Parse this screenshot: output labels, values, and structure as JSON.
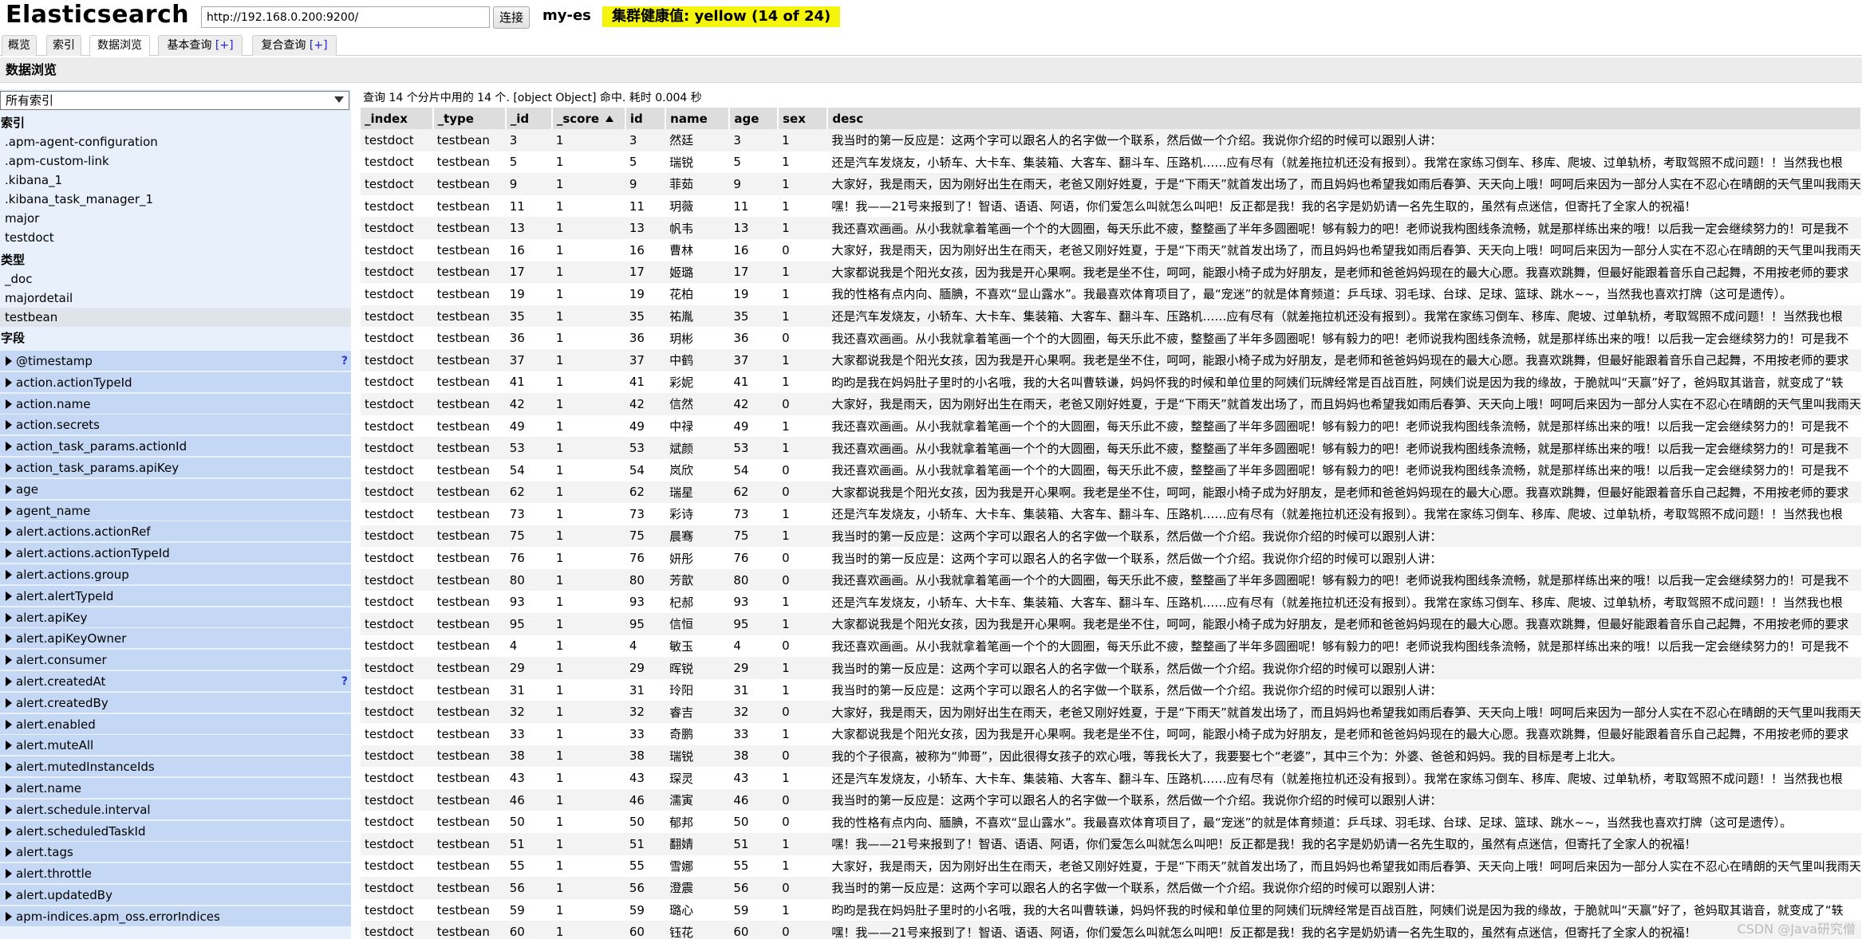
{
  "header": {
    "logo": "Elasticsearch",
    "url": "http://192.168.0.200:9200/",
    "connect_label": "连接",
    "cluster_name": "my-es",
    "health_text": "集群健康值: yellow (14 of 24)",
    "health_color": "#f4f40d"
  },
  "tabs": [
    {
      "label": "概览",
      "plus": ""
    },
    {
      "label": "索引",
      "plus": ""
    },
    {
      "label": "数据浏览",
      "plus": ""
    },
    {
      "label": "基本查询 ",
      "plus": "[+]"
    },
    {
      "label": "复合查询 ",
      "plus": "[+]"
    }
  ],
  "page_title": "数据浏览",
  "sidebar": {
    "index_select": "所有索引",
    "indices_label": "索引",
    "indices": [
      ".apm-agent-configuration",
      ".apm-custom-link",
      ".kibana_1",
      ".kibana_task_manager_1",
      "major",
      "testdoct"
    ],
    "types_label": "类型",
    "types": [
      "_doc",
      "majordetail",
      "testbean"
    ],
    "fields_label": "字段",
    "fields": [
      {
        "name": "@timestamp",
        "help": "?"
      },
      {
        "name": "action.actionTypeId",
        "help": ""
      },
      {
        "name": "action.name",
        "help": ""
      },
      {
        "name": "action.secrets",
        "help": ""
      },
      {
        "name": "action_task_params.actionId",
        "help": ""
      },
      {
        "name": "action_task_params.apiKey",
        "help": ""
      },
      {
        "name": "age",
        "help": ""
      },
      {
        "name": "agent_name",
        "help": ""
      },
      {
        "name": "alert.actions.actionRef",
        "help": ""
      },
      {
        "name": "alert.actions.actionTypeId",
        "help": ""
      },
      {
        "name": "alert.actions.group",
        "help": ""
      },
      {
        "name": "alert.alertTypeId",
        "help": ""
      },
      {
        "name": "alert.apiKey",
        "help": ""
      },
      {
        "name": "alert.apiKeyOwner",
        "help": ""
      },
      {
        "name": "alert.consumer",
        "help": ""
      },
      {
        "name": "alert.createdAt",
        "help": "?"
      },
      {
        "name": "alert.createdBy",
        "help": ""
      },
      {
        "name": "alert.enabled",
        "help": ""
      },
      {
        "name": "alert.muteAll",
        "help": ""
      },
      {
        "name": "alert.mutedInstanceIds",
        "help": ""
      },
      {
        "name": "alert.name",
        "help": ""
      },
      {
        "name": "alert.schedule.interval",
        "help": ""
      },
      {
        "name": "alert.scheduledTaskId",
        "help": ""
      },
      {
        "name": "alert.tags",
        "help": ""
      },
      {
        "name": "alert.throttle",
        "help": ""
      },
      {
        "name": "alert.updatedBy",
        "help": ""
      },
      {
        "name": "apm-indices.apm_oss.errorIndices",
        "help": ""
      }
    ]
  },
  "results": {
    "summary": "查询 14 个分片中用的 14 个. [object Object] 命中. 耗时 0.004 秒",
    "columns": [
      "_index",
      "_type",
      "_id",
      "_score",
      "id",
      "name",
      "age",
      "sex",
      "desc"
    ],
    "rows": [
      [
        "testdoct",
        "testbean",
        "3",
        "1",
        "3",
        "然廷",
        "3",
        "1",
        "我当时的第一反应是：这两个字可以跟名人的名字做一个联系，然后做一个介绍。我说你介绍的时候可以跟别人讲："
      ],
      [
        "testdoct",
        "testbean",
        "5",
        "1",
        "5",
        "瑞锐",
        "5",
        "1",
        "还是汽车发烧友，小轿车、大卡车、集装箱、大客车、翻斗车、压路机……应有尽有（就差拖拉机还没有报到）。我常在家练习倒车、移库、爬坡、过单轨桥，考取驾照不成问题！！当然我也根"
      ],
      [
        "testdoct",
        "testbean",
        "9",
        "1",
        "9",
        "菲茹",
        "9",
        "1",
        "大家好，我是雨天，因为刚好出生在雨天，老爸又刚好姓夏，于是“下雨天”就首发出场了，而且妈妈也希望我如雨后春笋、天天向上哦！呵呵后来因为一部分人实在不忍心在晴朗的天气里叫我雨天"
      ],
      [
        "testdoct",
        "testbean",
        "11",
        "1",
        "11",
        "玥薇",
        "11",
        "1",
        "嘿！我——21号来报到了！智语、语语、阿语，你们爱怎么叫就怎么叫吧！反正都是我！我的名字是奶奶请一名先生取的，虽然有点迷信，但寄托了全家人的祝福！"
      ],
      [
        "testdoct",
        "testbean",
        "13",
        "1",
        "13",
        "帆韦",
        "13",
        "1",
        "我还喜欢画画。从小我就拿着笔画一个个的大圆圈，每天乐此不疲，整整画了半年多圆圈呢！够有毅力的吧！老师说我构图线条流畅，就是那样练出来的哦！以后我一定会继续努力的！可是我不"
      ],
      [
        "testdoct",
        "testbean",
        "16",
        "1",
        "16",
        "曹林",
        "16",
        "0",
        "大家好，我是雨天，因为刚好出生在雨天，老爸又刚好姓夏，于是“下雨天”就首发出场了，而且妈妈也希望我如雨后春笋、天天向上哦！呵呵后来因为一部分人实在不忍心在晴朗的天气里叫我雨天"
      ],
      [
        "testdoct",
        "testbean",
        "17",
        "1",
        "17",
        "姬璐",
        "17",
        "1",
        "大家都说我是个阳光女孩，因为我是开心果啊。我老是坐不住，呵呵，能跟小椅子成为好朋友，是老师和爸爸妈妈现在的最大心愿。我喜欢跳舞，但最好能跟着音乐自己起舞，不用按老师的要求"
      ],
      [
        "testdoct",
        "testbean",
        "19",
        "1",
        "19",
        "花柏",
        "19",
        "1",
        "我的性格有点内向、腼腆，不喜欢“显山露水”。我最喜欢体育项目了，最“宠迷”的就是体育频道：乒乓球、羽毛球、台球、足球、篮球、跳水~~，当然我也喜欢打牌（这可是遗传）。"
      ],
      [
        "testdoct",
        "testbean",
        "35",
        "1",
        "35",
        "祐胤",
        "35",
        "1",
        "还是汽车发烧友，小轿车、大卡车、集装箱、大客车、翻斗车、压路机……应有尽有（就差拖拉机还没有报到）。我常在家练习倒车、移库、爬坡、过单轨桥，考取驾照不成问题！！当然我也根"
      ],
      [
        "testdoct",
        "testbean",
        "36",
        "1",
        "36",
        "玥彬",
        "36",
        "0",
        "我还喜欢画画。从小我就拿着笔画一个个的大圆圈，每天乐此不疲，整整画了半年多圆圈呢！够有毅力的吧！老师说我构图线条流畅，就是那样练出来的哦！以后我一定会继续努力的！可是我不"
      ],
      [
        "testdoct",
        "testbean",
        "37",
        "1",
        "37",
        "中鹤",
        "37",
        "1",
        "大家都说我是个阳光女孩，因为我是开心果啊。我老是坐不住，呵呵，能跟小椅子成为好朋友，是老师和爸爸妈妈现在的最大心愿。我喜欢跳舞，但最好能跟着音乐自己起舞，不用按老师的要求"
      ],
      [
        "testdoct",
        "testbean",
        "41",
        "1",
        "41",
        "彩妮",
        "41",
        "1",
        "昀昀是我在妈妈肚子里时的小名哦，我的大名叫曹轶谦，妈妈怀我的时候和单位里的阿姨们玩牌经常是百战百胜，阿姨们说是因为我的缘故，于脆就叫“天赢”好了，爸妈取其谐音，就变成了“轶"
      ],
      [
        "testdoct",
        "testbean",
        "42",
        "1",
        "42",
        "信然",
        "42",
        "0",
        "大家好，我是雨天，因为刚好出生在雨天，老爸又刚好姓夏，于是“下雨天”就首发出场了，而且妈妈也希望我如雨后春笋、天天向上哦！呵呵后来因为一部分人实在不忍心在晴朗的天气里叫我雨天"
      ],
      [
        "testdoct",
        "testbean",
        "49",
        "1",
        "49",
        "中禄",
        "49",
        "1",
        "我还喜欢画画。从小我就拿着笔画一个个的大圆圈，每天乐此不疲，整整画了半年多圆圈呢！够有毅力的吧！老师说我构图线条流畅，就是那样练出来的哦！以后我一定会继续努力的！可是我不"
      ],
      [
        "testdoct",
        "testbean",
        "53",
        "1",
        "53",
        "斌颜",
        "53",
        "1",
        "我还喜欢画画。从小我就拿着笔画一个个的大圆圈，每天乐此不疲，整整画了半年多圆圈呢！够有毅力的吧！老师说我构图线条流畅，就是那样练出来的哦！以后我一定会继续努力的！可是我不"
      ],
      [
        "testdoct",
        "testbean",
        "54",
        "1",
        "54",
        "岚欣",
        "54",
        "0",
        "我还喜欢画画。从小我就拿着笔画一个个的大圆圈，每天乐此不疲，整整画了半年多圆圈呢！够有毅力的吧！老师说我构图线条流畅，就是那样练出来的哦！以后我一定会继续努力的！可是我不"
      ],
      [
        "testdoct",
        "testbean",
        "62",
        "1",
        "62",
        "瑞星",
        "62",
        "0",
        "大家都说我是个阳光女孩，因为我是开心果啊。我老是坐不住，呵呵，能跟小椅子成为好朋友，是老师和爸爸妈妈现在的最大心愿。我喜欢跳舞，但最好能跟着音乐自己起舞，不用按老师的要求"
      ],
      [
        "testdoct",
        "testbean",
        "73",
        "1",
        "73",
        "彩诗",
        "73",
        "1",
        "还是汽车发烧友，小轿车、大卡车、集装箱、大客车、翻斗车、压路机……应有尽有（就差拖拉机还没有报到）。我常在家练习倒车、移库、爬坡、过单轨桥，考取驾照不成问题！！当然我也根"
      ],
      [
        "testdoct",
        "testbean",
        "75",
        "1",
        "75",
        "晨骞",
        "75",
        "1",
        "我当时的第一反应是：这两个字可以跟名人的名字做一个联系，然后做一个介绍。我说你介绍的时候可以跟别人讲："
      ],
      [
        "testdoct",
        "testbean",
        "76",
        "1",
        "76",
        "妍彤",
        "76",
        "0",
        "我当时的第一反应是：这两个字可以跟名人的名字做一个联系，然后做一个介绍。我说你介绍的时候可以跟别人讲："
      ],
      [
        "testdoct",
        "testbean",
        "80",
        "1",
        "80",
        "芳歆",
        "80",
        "0",
        "我还喜欢画画。从小我就拿着笔画一个个的大圆圈，每天乐此不疲，整整画了半年多圆圈呢！够有毅力的吧！老师说我构图线条流畅，就是那样练出来的哦！以后我一定会继续努力的！可是我不"
      ],
      [
        "testdoct",
        "testbean",
        "93",
        "1",
        "93",
        "杞郝",
        "93",
        "1",
        "还是汽车发烧友，小轿车、大卡车、集装箱、大客车、翻斗车、压路机……应有尽有（就差拖拉机还没有报到）。我常在家练习倒车、移库、爬坡、过单轨桥，考取驾照不成问题！！当然我也根"
      ],
      [
        "testdoct",
        "testbean",
        "95",
        "1",
        "95",
        "信恒",
        "95",
        "1",
        "大家都说我是个阳光女孩，因为我是开心果啊。我老是坐不住，呵呵，能跟小椅子成为好朋友，是老师和爸爸妈妈现在的最大心愿。我喜欢跳舞，但最好能跟着音乐自己起舞，不用按老师的要求"
      ],
      [
        "testdoct",
        "testbean",
        "4",
        "1",
        "4",
        "敏玉",
        "4",
        "0",
        "我还喜欢画画。从小我就拿着笔画一个个的大圆圈，每天乐此不疲，整整画了半年多圆圈呢！够有毅力的吧！老师说我构图线条流畅，就是那样练出来的哦！以后我一定会继续努力的！可是我不"
      ],
      [
        "testdoct",
        "testbean",
        "29",
        "1",
        "29",
        "晖锐",
        "29",
        "1",
        "我当时的第一反应是：这两个字可以跟名人的名字做一个联系，然后做一个介绍。我说你介绍的时候可以跟别人讲："
      ],
      [
        "testdoct",
        "testbean",
        "31",
        "1",
        "31",
        "玲阳",
        "31",
        "1",
        "我当时的第一反应是：这两个字可以跟名人的名字做一个联系，然后做一个介绍。我说你介绍的时候可以跟别人讲："
      ],
      [
        "testdoct",
        "testbean",
        "32",
        "1",
        "32",
        "睿吉",
        "32",
        "0",
        "大家好，我是雨天，因为刚好出生在雨天，老爸又刚好姓夏，于是“下雨天”就首发出场了，而且妈妈也希望我如雨后春笋、天天向上哦！呵呵后来因为一部分人实在不忍心在晴朗的天气里叫我雨天"
      ],
      [
        "testdoct",
        "testbean",
        "33",
        "1",
        "33",
        "奇鹏",
        "33",
        "1",
        "大家都说我是个阳光女孩，因为我是开心果啊。我老是坐不住，呵呵，能跟小椅子成为好朋友，是老师和爸爸妈妈现在的最大心愿。我喜欢跳舞，但最好能跟着音乐自己起舞，不用按老师的要求"
      ],
      [
        "testdoct",
        "testbean",
        "38",
        "1",
        "38",
        "瑞锐",
        "38",
        "0",
        "我的个子很高，被称为“帅哥”，因此很得女孩子的欢心哦，等我长大了，我要娶七个“老婆”，其中三个为：外婆、爸爸和妈妈。我的目标是考上北大。"
      ],
      [
        "testdoct",
        "testbean",
        "43",
        "1",
        "43",
        "琛灵",
        "43",
        "1",
        "还是汽车发烧友，小轿车、大卡车、集装箱、大客车、翻斗车、压路机……应有尽有（就差拖拉机还没有报到）。我常在家练习倒车、移库、爬坡、过单轨桥，考取驾照不成问题！！当然我也根"
      ],
      [
        "testdoct",
        "testbean",
        "46",
        "1",
        "46",
        "濡寅",
        "46",
        "0",
        "我当时的第一反应是：这两个字可以跟名人的名字做一个联系，然后做一个介绍。我说你介绍的时候可以跟别人讲："
      ],
      [
        "testdoct",
        "testbean",
        "50",
        "1",
        "50",
        "郁邦",
        "50",
        "0",
        "我的性格有点内向、腼腆，不喜欢“显山露水”。我最喜欢体育项目了，最“宠迷”的就是体育频道：乒乓球、羽毛球、台球、足球、篮球、跳水~~，当然我也喜欢打牌（这可是遗传）。"
      ],
      [
        "testdoct",
        "testbean",
        "51",
        "1",
        "51",
        "翻婧",
        "51",
        "1",
        "嘿！我——21号来报到了！智语、语语、阿语，你们爱怎么叫就怎么叫吧！反正都是我！我的名字是奶奶请一名先生取的，虽然有点迷信，但寄托了全家人的祝福！"
      ],
      [
        "testdoct",
        "testbean",
        "55",
        "1",
        "55",
        "雪娜",
        "55",
        "1",
        "大家好，我是雨天，因为刚好出生在雨天，老爸又刚好姓夏，于是“下雨天”就首发出场了，而且妈妈也希望我如雨后春笋、天天向上哦！呵呵后来因为一部分人实在不忍心在晴朗的天气里叫我雨天"
      ],
      [
        "testdoct",
        "testbean",
        "56",
        "1",
        "56",
        "澄震",
        "56",
        "0",
        "我当时的第一反应是：这两个字可以跟名人的名字做一个联系，然后做一个介绍。我说你介绍的时候可以跟别人讲："
      ],
      [
        "testdoct",
        "testbean",
        "59",
        "1",
        "59",
        "璐心",
        "59",
        "1",
        "昀昀是我在妈妈肚子里时的小名哦，我的大名叫曹轶谦，妈妈怀我的时候和单位里的阿姨们玩牌经常是百战百胜，阿姨们说是因为我的缘故，于脆就叫“天赢”好了，爸妈取其谐音，就变成了“轶"
      ],
      [
        "testdoct",
        "testbean",
        "60",
        "1",
        "60",
        "钰花",
        "60",
        "0",
        "嘿！我——21号来报到了！智语、语语、阿语，你们爱怎么叫就怎么叫吧！反正都是我！我的名字是奶奶请一名先生取的，虽然有点迷信，但寄托了全家人的祝福！"
      ]
    ]
  },
  "watermark": "CSDN @Java研究僧"
}
